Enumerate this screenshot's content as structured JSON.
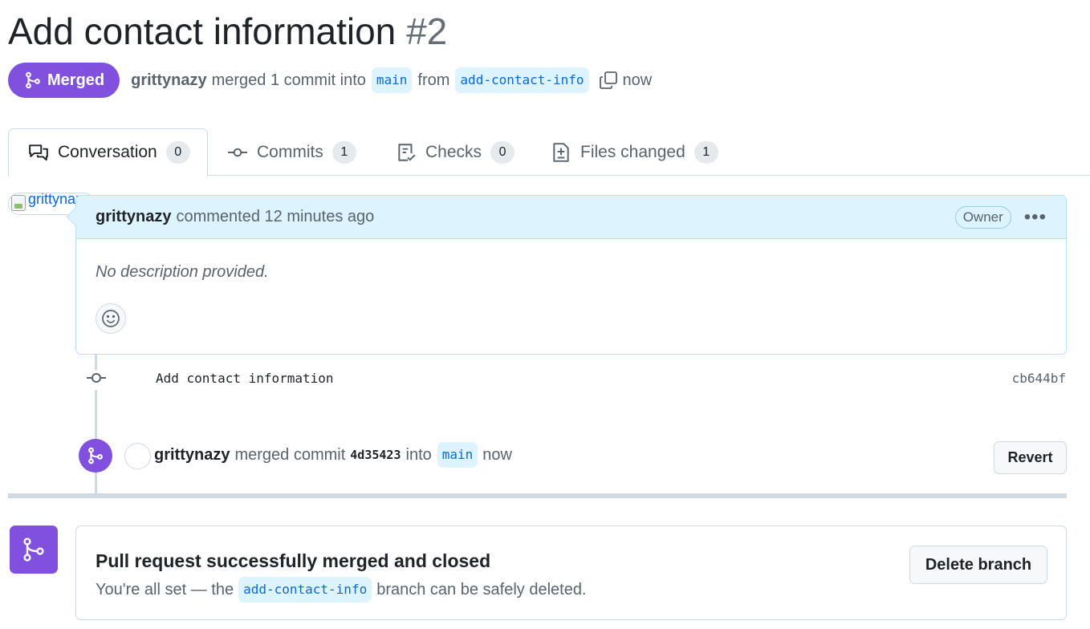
{
  "pr": {
    "title": "Add contact information",
    "number": "#2",
    "state_label": "Merged",
    "author": "grittynazy",
    "summary_verb": "merged 1 commit into",
    "base_branch": "main",
    "from_word": "from",
    "head_branch": "add-contact-info",
    "time": "now"
  },
  "tabs": [
    {
      "label": "Conversation",
      "count": "0",
      "icon": "comment-discussion-icon",
      "active": true
    },
    {
      "label": "Commits",
      "count": "1",
      "icon": "git-commit-icon",
      "active": false
    },
    {
      "label": "Checks",
      "count": "0",
      "icon": "checklist-icon",
      "active": false
    },
    {
      "label": "Files changed",
      "count": "1",
      "icon": "file-diff-icon",
      "active": false
    }
  ],
  "comment": {
    "avatar_alt": "grittynazy",
    "author": "grittynazy",
    "meta": "commented 12 minutes ago",
    "badge": "Owner",
    "menu": "•••",
    "body": "No description provided."
  },
  "commit": {
    "message": "Add contact information",
    "sha": "cb644bf"
  },
  "merge_event": {
    "author": "grittynazy",
    "verb": "merged commit",
    "sha": "4d35423",
    "into_word": "into",
    "branch": "main",
    "time": "now",
    "revert_label": "Revert"
  },
  "merged_box": {
    "title": "Pull request successfully merged and closed",
    "sub_before": "You're all set — the",
    "branch": "add-contact-info",
    "sub_after": "branch can be safely deleted.",
    "delete_label": "Delete branch"
  },
  "colors": {
    "merged_purple": "#8250df",
    "branch_bg": "#ddf4ff",
    "link_blue": "#0969da"
  }
}
